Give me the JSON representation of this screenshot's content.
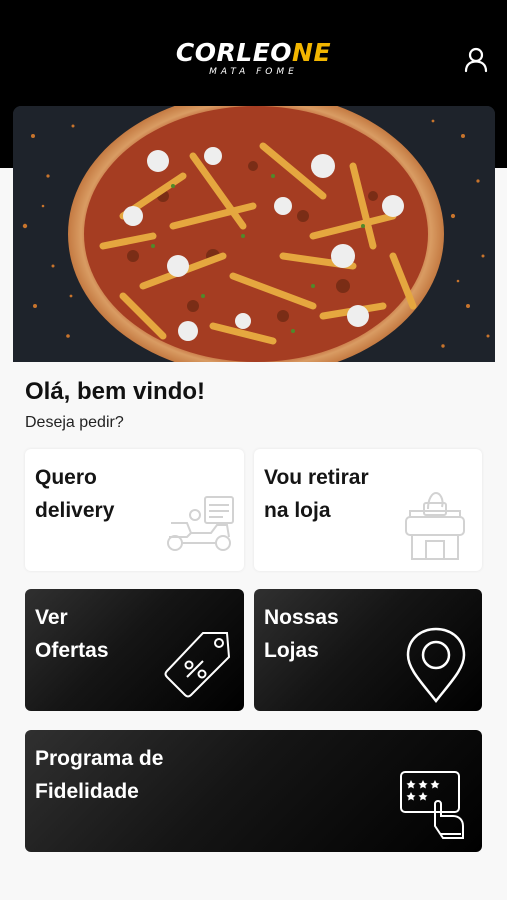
{
  "header": {
    "logo_main_a": "CORLEO",
    "logo_main_b": "NE",
    "logo_sub": "MATA FOME",
    "icons": {
      "account": "user-icon"
    }
  },
  "hero": {
    "image": "pizza-with-fries-photo"
  },
  "welcome": {
    "title": "Olá, bem vindo!",
    "subtitle": "Deseja pedir?"
  },
  "cards": {
    "delivery": {
      "label": "Quero\ndelivery",
      "icon": "delivery-scooter-icon"
    },
    "pickup": {
      "label": "Vou retirar\nna loja",
      "icon": "store-pickup-icon"
    },
    "offers": {
      "label": "Ver\nOfertas",
      "icon": "discount-tag-icon"
    },
    "stores": {
      "label": "Nossas\nLojas",
      "icon": "map-pin-icon"
    },
    "loyalty": {
      "label": "Programa de\nFidelidade",
      "icon": "loyalty-card-icon"
    }
  },
  "colors": {
    "header_bg": "#000000",
    "brand_accent": "#f2b600",
    "card_light": "#ffffff",
    "card_dark": "#1a1a1a",
    "page_bg": "#f8f8f8"
  }
}
